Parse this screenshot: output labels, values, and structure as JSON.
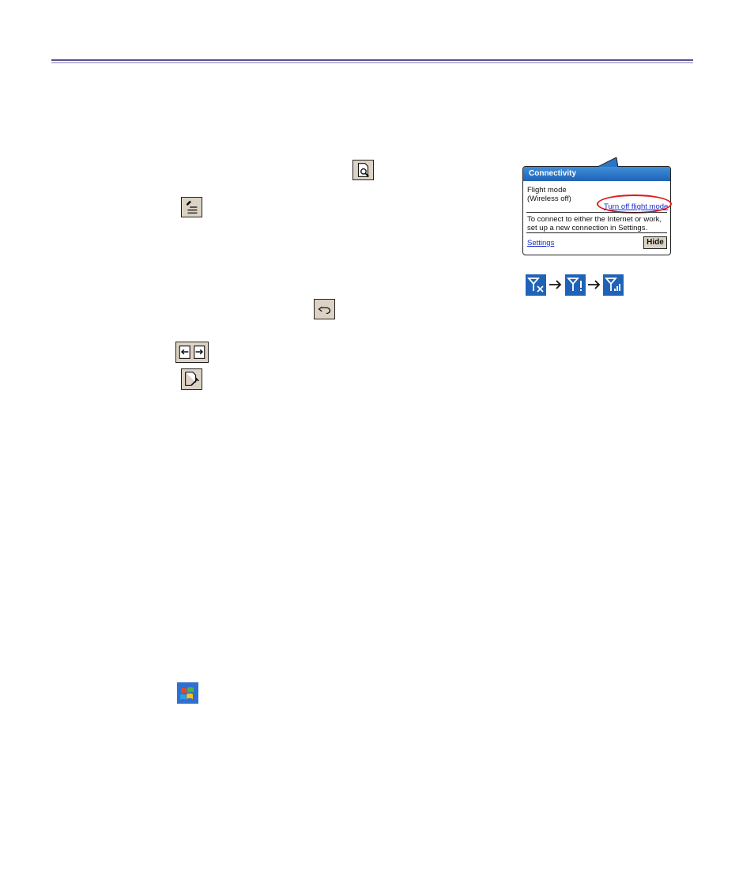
{
  "popup": {
    "title": "Connectivity",
    "status_line1": "Flight mode",
    "status_line2": "(Wireless off)",
    "turn_off_link": "Turn off flight mode",
    "info_line1": "To connect to either the Internet or work,",
    "info_line2": "set up a new connection in Settings.",
    "settings_link": "Settings",
    "hide_button": "Hide"
  },
  "colors": {
    "rule": "#5a4e8e",
    "titlebar": "#1f63b8",
    "highlight_oval": "#e01818",
    "link": "#1a2cc9",
    "icon_face": "#dcd3c4"
  },
  "icons": [
    "zoom-page-icon",
    "format-lines-icon",
    "undo-icon",
    "page-prev-next-icon",
    "document-tools-icon",
    "signal-off-icon",
    "signal-searching-icon",
    "signal-full-icon",
    "windows-start-icon"
  ]
}
